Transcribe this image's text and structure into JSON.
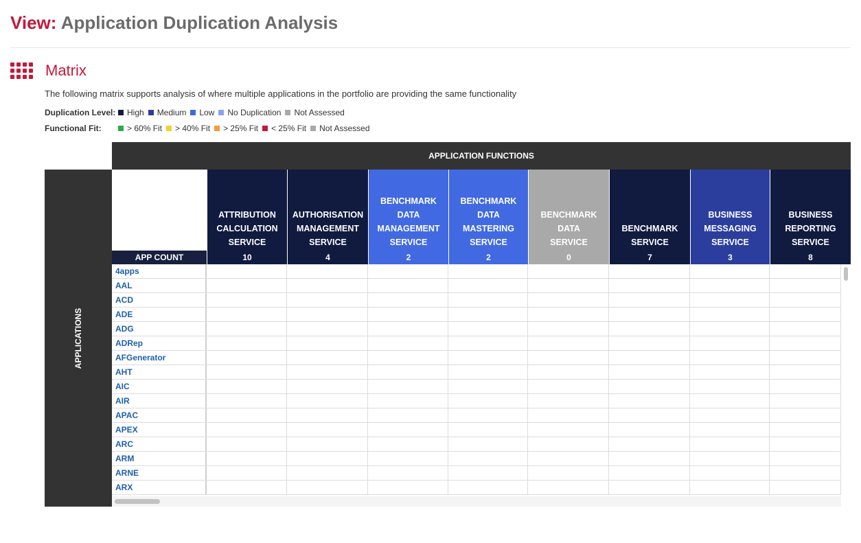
{
  "header": {
    "view_label": "View:",
    "view_title": "Application Duplication Analysis"
  },
  "section": {
    "title": "Matrix",
    "icon": "grid-icon"
  },
  "description": "The following matrix supports analysis of where multiple applications in the portfolio are providing the same functionality",
  "legend": {
    "duplication": {
      "label": "Duplication Level:",
      "items": [
        {
          "label": "High",
          "color": "#111a3f"
        },
        {
          "label": "Medium",
          "color": "#2b3e9e"
        },
        {
          "label": "Low",
          "color": "#4169e1"
        },
        {
          "label": "No Duplication",
          "color": "#8aa2ee"
        },
        {
          "label": "Not Assessed",
          "color": "#a9a9a9"
        }
      ]
    },
    "fit": {
      "label": "Functional Fit:",
      "items": [
        {
          "label": "> 60% Fit",
          "color": "#2ea84f"
        },
        {
          "label": "> 40% Fit",
          "color": "#f2d12a"
        },
        {
          "label": "> 25% Fit",
          "color": "#f59b3c"
        },
        {
          "label": "< 25% Fit",
          "color": "#c3193b"
        },
        {
          "label": "Not Assessed",
          "color": "#a9a9a9"
        }
      ]
    }
  },
  "matrix": {
    "functions_label": "APPLICATION FUNCTIONS",
    "applications_label": "APPLICATIONS",
    "count_label": "APP COUNT",
    "columns": [
      {
        "lines": [
          "ATTRIBUTION",
          "CALCULATION",
          "SERVICE"
        ],
        "count": "10",
        "color": "#111a3f"
      },
      {
        "lines": [
          "AUTHORISATION",
          "MANAGEMENT",
          "SERVICE"
        ],
        "count": "4",
        "color": "#111a3f"
      },
      {
        "lines": [
          "BENCHMARK DATA",
          "MANAGEMENT",
          "SERVICE"
        ],
        "count": "2",
        "color": "#4169e1"
      },
      {
        "lines": [
          "BENCHMARK DATA",
          "MASTERING",
          "SERVICE"
        ],
        "count": "2",
        "color": "#4169e1"
      },
      {
        "lines": [
          "BENCHMARK DATA",
          "SERVICE"
        ],
        "count": "0",
        "color": "#a9a9a9"
      },
      {
        "lines": [
          "BENCHMARK",
          "SERVICE"
        ],
        "count": "7",
        "color": "#111a3f"
      },
      {
        "lines": [
          "BUSINESS",
          "MESSAGING",
          "SERVICE"
        ],
        "count": "3",
        "color": "#2b3e9e"
      },
      {
        "lines": [
          "BUSINESS",
          "REPORTING",
          "SERVICE"
        ],
        "count": "8",
        "color": "#111a3f"
      }
    ],
    "apps": [
      "4apps",
      "AAL",
      "ACD",
      "ADE",
      "ADG",
      "ADRep",
      "AFGenerator",
      "AHT",
      "AIC",
      "AIR",
      "APAC",
      "APEX",
      "ARC",
      "ARM",
      "ARNE",
      "ARX"
    ]
  }
}
